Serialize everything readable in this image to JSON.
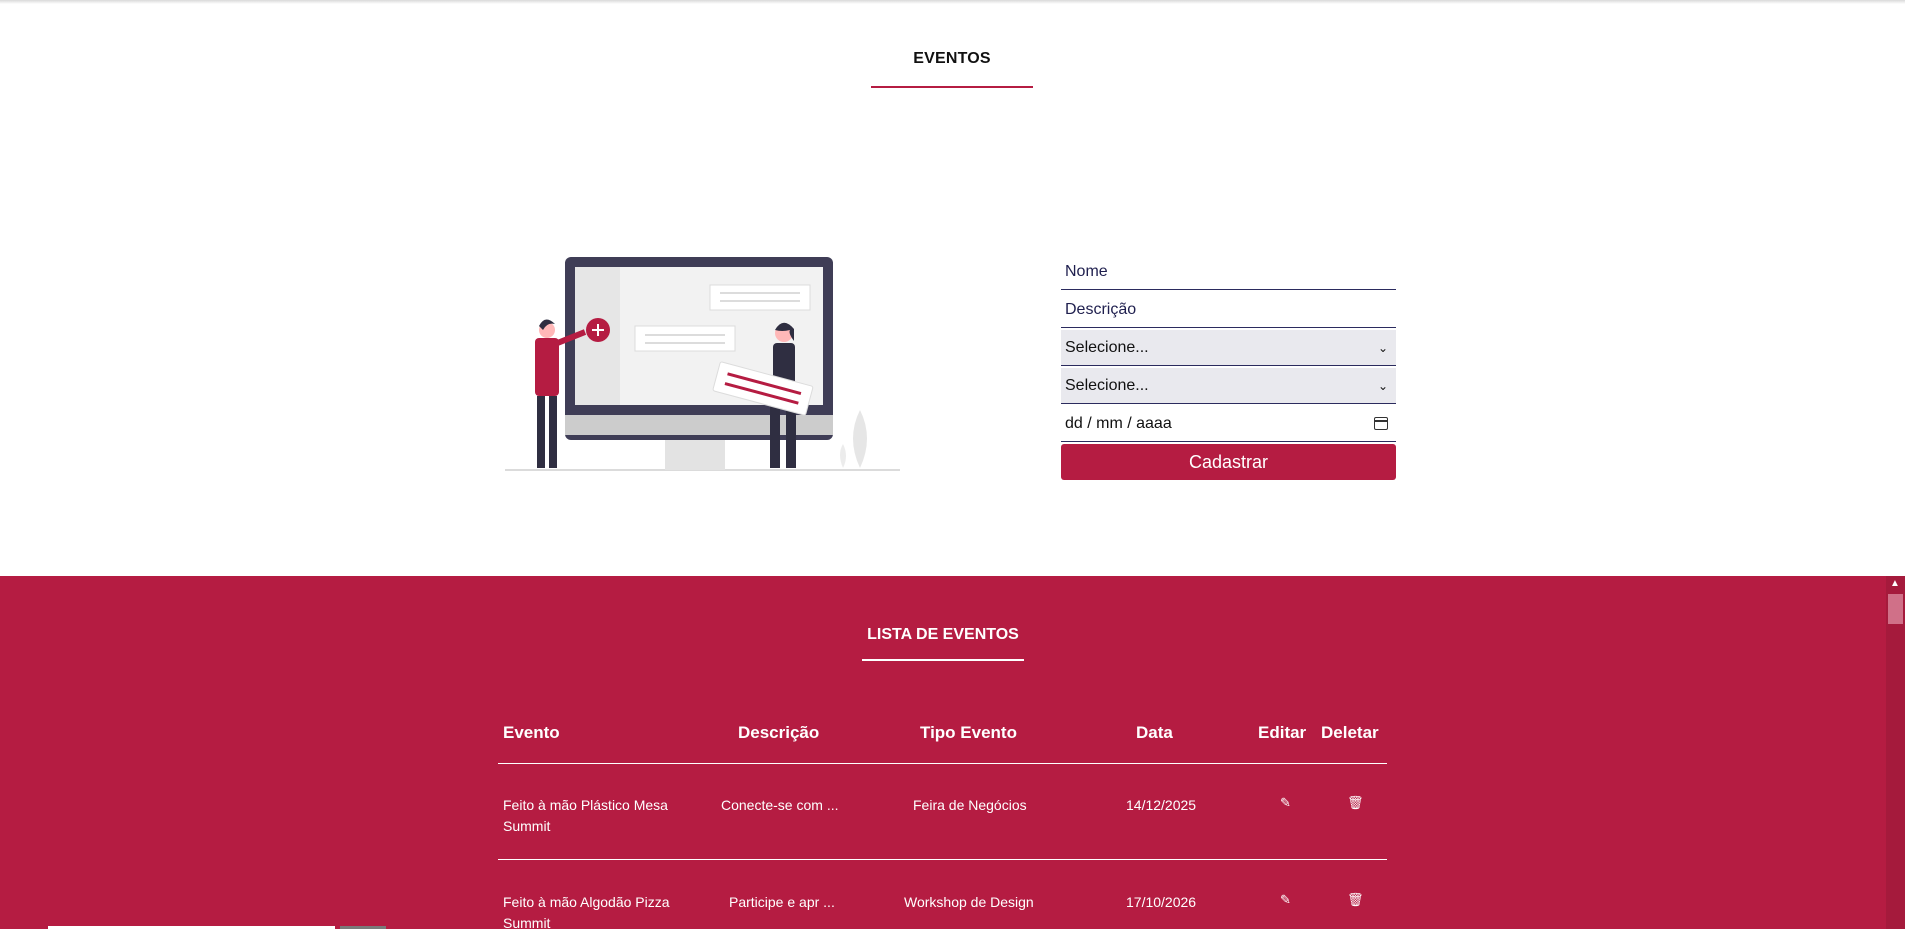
{
  "header": {
    "title": "EVENTOS"
  },
  "form": {
    "nome_placeholder": "Nome",
    "descricao_placeholder": "Descrição",
    "tipo_select": "Selecione...",
    "instituicao_select": "Selecione...",
    "date_placeholder": "dd / mm / aaaa",
    "submit_label": "Cadastrar"
  },
  "list": {
    "title": "LISTA DE EVENTOS",
    "columns": [
      "Evento",
      "Descrição",
      "Tipo Evento",
      "Data",
      "Editar",
      "Deletar"
    ],
    "rows": [
      {
        "evento": "Feito à mão Plástico Mesa Summit",
        "descricao": "Conecte-se com ...",
        "tipo": "Feira de Negócios",
        "data": "14/12/2025"
      },
      {
        "evento": "Feito à mão Algodão Pizza Summit",
        "descricao": "Participe e apr ...",
        "tipo": "Workshop de Design",
        "data": "17/10/2026"
      }
    ]
  },
  "icons": {
    "edit": "pencil-icon",
    "delete": "trash-icon",
    "calendar": "calendar-icon",
    "chevron": "chevron-down-icon"
  },
  "colors": {
    "accent": "#b51c42",
    "text_dark": "#1f1f4e"
  }
}
